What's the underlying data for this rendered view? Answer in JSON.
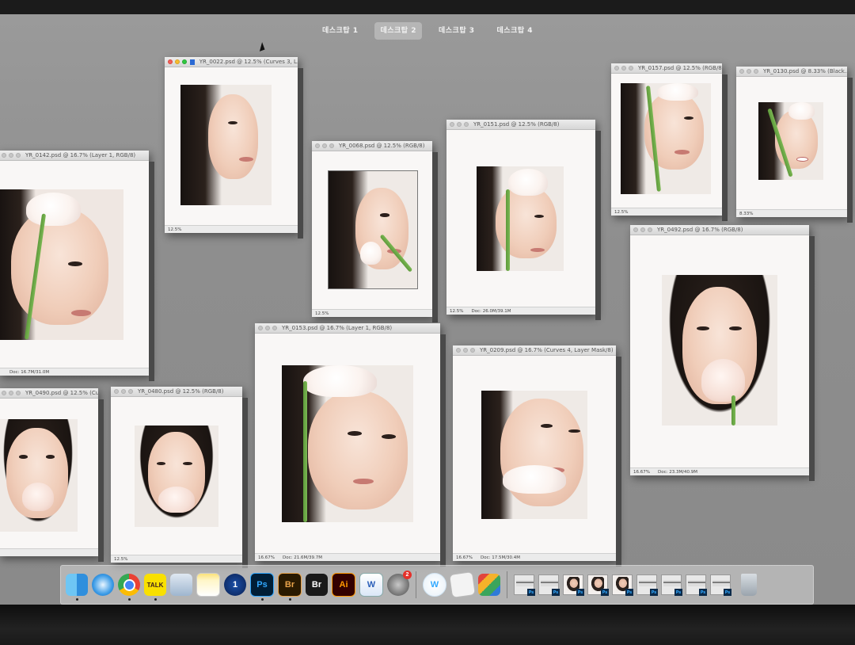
{
  "spaces": {
    "tabs": [
      {
        "label": "데스크탑 1"
      },
      {
        "label": "데스크탑 2"
      },
      {
        "label": "데스크탑 3"
      },
      {
        "label": "데스크탑 4"
      }
    ],
    "active_index": 1
  },
  "windows": [
    {
      "title": "YR_0022.psd @ 12.5% (Curves 3, L...",
      "zoom": "12.5%",
      "doc": ""
    },
    {
      "title": "YR_0142.psd @ 16.7% (Layer 1, RGB/8)",
      "zoom": "",
      "doc": "Doc: 16.7M/31.0M"
    },
    {
      "title": "YR_0068.psd @ 12.5% (RGB/8)",
      "zoom": "12.5%",
      "doc": ""
    },
    {
      "title": "YR_0151.psd @ 12.5% (RGB/8)",
      "zoom": "12.5%",
      "doc": "Doc: 26.0M/39.1M"
    },
    {
      "title": "YR_0157.psd @ 12.5% (RGB/8)",
      "zoom": "12.5%",
      "doc": ""
    },
    {
      "title": "YR_0130.psd @ 8.33% (Black...",
      "zoom": "8.33%",
      "doc": ""
    },
    {
      "title": "YR_0492.psd @ 16.7% (RGB/8)",
      "zoom": "16.67%",
      "doc": "Doc: 23.3M/40.9M"
    },
    {
      "title": "YR_0153.psd @ 16.7% (Layer 1, RGB/8)",
      "zoom": "16.67%",
      "doc": "Doc: 21.6M/39.7M"
    },
    {
      "title": "YR_0209.psd @ 16.7% (Curves 4, Layer Mask/8)",
      "zoom": "16.67%",
      "doc": "Doc: 17.5M/30.4M"
    },
    {
      "title": "YR_0490.psd @ 12.5% (Curves...",
      "zoom": "",
      "doc": ""
    },
    {
      "title": "YR_0480.psd @ 12.5% (RGB/8)",
      "zoom": "12.5%",
      "doc": ""
    }
  ],
  "dock": {
    "apps": [
      {
        "icon": "finder-icon",
        "label": ""
      },
      {
        "icon": "safari-icon",
        "label": ""
      },
      {
        "icon": "chrome-icon",
        "label": ""
      },
      {
        "icon": "kakaotalk-icon",
        "label": "TALK"
      },
      {
        "icon": "preview-icon",
        "label": ""
      },
      {
        "icon": "notes-icon",
        "label": ""
      },
      {
        "icon": "1password-icon",
        "label": "1"
      },
      {
        "icon": "photoshop-icon",
        "label": "Ps"
      },
      {
        "icon": "bridge-icon",
        "label": "Br"
      },
      {
        "icon": "bridge-alt-icon",
        "label": "Br"
      },
      {
        "icon": "illustrator-icon",
        "label": "Ai"
      },
      {
        "icon": "word-icon",
        "label": "W"
      },
      {
        "icon": "system-preferences-icon",
        "label": "",
        "badge": "2"
      }
    ],
    "docs": [
      {
        "icon": "w-app-icon",
        "label": "W"
      },
      {
        "icon": "document-icon",
        "label": ""
      },
      {
        "icon": "downloads-stack-icon",
        "label": ""
      }
    ],
    "thumbnails": [
      {
        "label": "Ps"
      },
      {
        "label": "Ps"
      },
      {
        "label": "Ps"
      },
      {
        "label": "Ps"
      },
      {
        "label": "Ps"
      },
      {
        "label": "Ps"
      },
      {
        "label": "Ps"
      },
      {
        "label": "Ps"
      },
      {
        "label": "Ps"
      }
    ]
  },
  "colors": {
    "desktop": "#8e8e8e",
    "photoshop_blue": "#31a8ff",
    "illustrator_orange": "#ff9a00",
    "bridge_orange": "#e8a34a"
  }
}
